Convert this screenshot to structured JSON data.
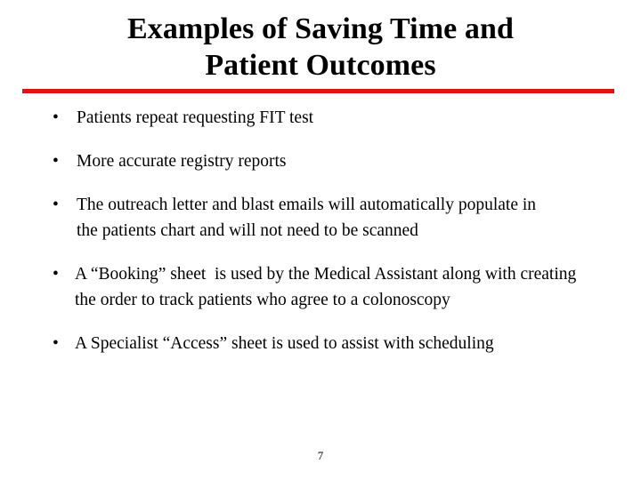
{
  "slide": {
    "title": {
      "line1": "Examples of Saving Time and",
      "line2": "Patient Outcomes"
    },
    "divider_color": "#DD1116",
    "bullets": [
      {
        "marker": "•",
        "text": "Patients repeat requesting FIT test"
      },
      {
        "marker": "•",
        "text": "More accurate registry reports"
      },
      {
        "marker": "•",
        "text": "The outreach letter and blast emails will automatically populate in the patients chart and will not need to be scanned"
      },
      {
        "marker": "•",
        "text": "A “Booking” sheet  is used by the Medical Assistant along with creating the order to track patients who agree to a colonoscopy"
      },
      {
        "marker": "•",
        "text": "A Specialist “Access” sheet is used to assist with scheduling"
      }
    ],
    "page_number": "7"
  }
}
